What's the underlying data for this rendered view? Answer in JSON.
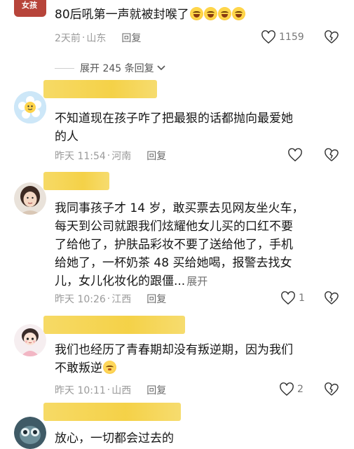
{
  "top_comment": {
    "badge": "女孩",
    "text": "80后吼第一声就被封喉了",
    "time": "2天前",
    "location": "山东",
    "reply_label": "回复",
    "likes": "1159"
  },
  "expand": {
    "label": "展开 245 条回复",
    "chevron": "chevron-down-icon"
  },
  "comments": [
    {
      "text_line1": "不知道现在孩子咋了把最狠的话都抛向最爱她",
      "text_line2": "的人",
      "time": "昨天 11:54",
      "location": "河南",
      "reply_label": "回复",
      "likes": ""
    },
    {
      "text_line1": "我同事孩子才 14 岁，敢买票去见网友坐火车，",
      "text_line2": "每天到公司就跟我们炫耀他女儿买的口红不要",
      "text_line3": "了给他了，护肤品彩妆不要了送给他了，手机",
      "text_line4": "给她了，一杯奶茶 48 买给她喝，报警去找女",
      "text_line5": "儿，女儿化妆化的跟僵...",
      "more_label": "展开",
      "time": "昨天 10:26",
      "location": "江西",
      "reply_label": "回复",
      "likes": "1"
    },
    {
      "text_line1": "我们也经历了青春期却没有叛逆期，因为我们",
      "text_line2": "不敢叛逆",
      "time": "昨天 10:11",
      "location": "山西",
      "reply_label": "回复",
      "likes": "2"
    },
    {
      "text_line1": "放心，一切都会过去的"
    }
  ],
  "separator": "·",
  "colors": {
    "blot": "#f4cf3e",
    "meta": "#9a9a9a",
    "text": "#161616"
  }
}
